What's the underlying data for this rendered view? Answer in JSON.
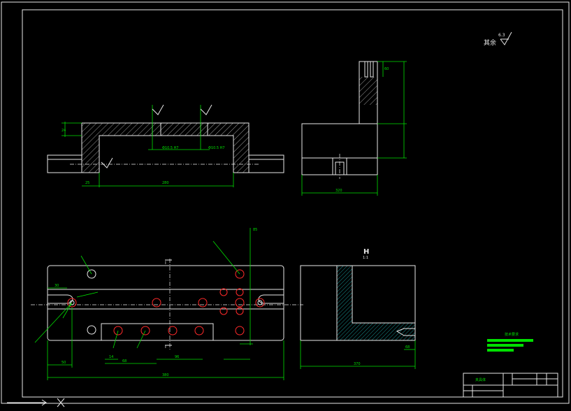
{
  "surface_note": {
    "label": "其余",
    "roughness": "6.3"
  },
  "dims": {
    "top_left": "25",
    "top_width": "280",
    "top_height": "24",
    "side_width": "320",
    "side_top": "60",
    "plan_total": "380",
    "plan_left": "50",
    "plan_30": "30",
    "plan_68": "68",
    "plan_14": "14",
    "plan_96": "96",
    "plan_85": "85",
    "right_width": "370",
    "right_68": "68"
  },
  "section_mark": "H",
  "section_label": "1:1",
  "section_letter": "I",
  "title_block": {
    "name": "夹具体",
    "cells": [
      "",
      "",
      "",
      "",
      "",
      ""
    ]
  },
  "tech_note": "技术要求"
}
